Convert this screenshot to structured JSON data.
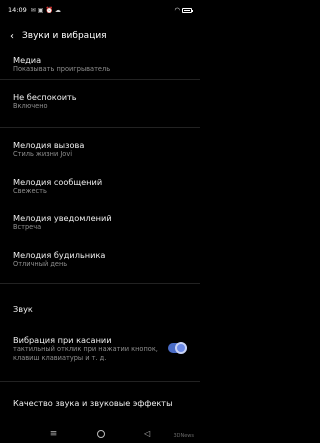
{
  "status_bar": {
    "time": "14:09",
    "icons": [
      "email-icon",
      "image-icon",
      "alarm-icon",
      "cloud-icon"
    ],
    "signal": "wifi-icon",
    "battery": 0.75
  },
  "header": {
    "title": "Звуки и вибрация"
  },
  "items": [
    {
      "label": "Медиа",
      "sub": "Показывать проигрыватель"
    },
    {
      "label": "Не беспокоить",
      "sub": "Включено"
    },
    {
      "label": "Мелодия вызова",
      "sub": "Стиль жизни Jovi"
    },
    {
      "label": "Мелодия сообщений",
      "sub": "Свежесть"
    },
    {
      "label": "Мелодия уведомлений",
      "sub": "Встреча"
    },
    {
      "label": "Мелодия будильника",
      "sub": "Отличный день"
    }
  ],
  "sound_section": {
    "title": "Звук"
  },
  "vibration": {
    "label": "Вибрация при касании",
    "sub": "тактильный отклик при нажатии кнопок, клавиш клавиатуры и т. д.",
    "enabled": true
  },
  "quality": {
    "label": "Качество звука и звуковые эффекты"
  },
  "watermark": "3DNews"
}
